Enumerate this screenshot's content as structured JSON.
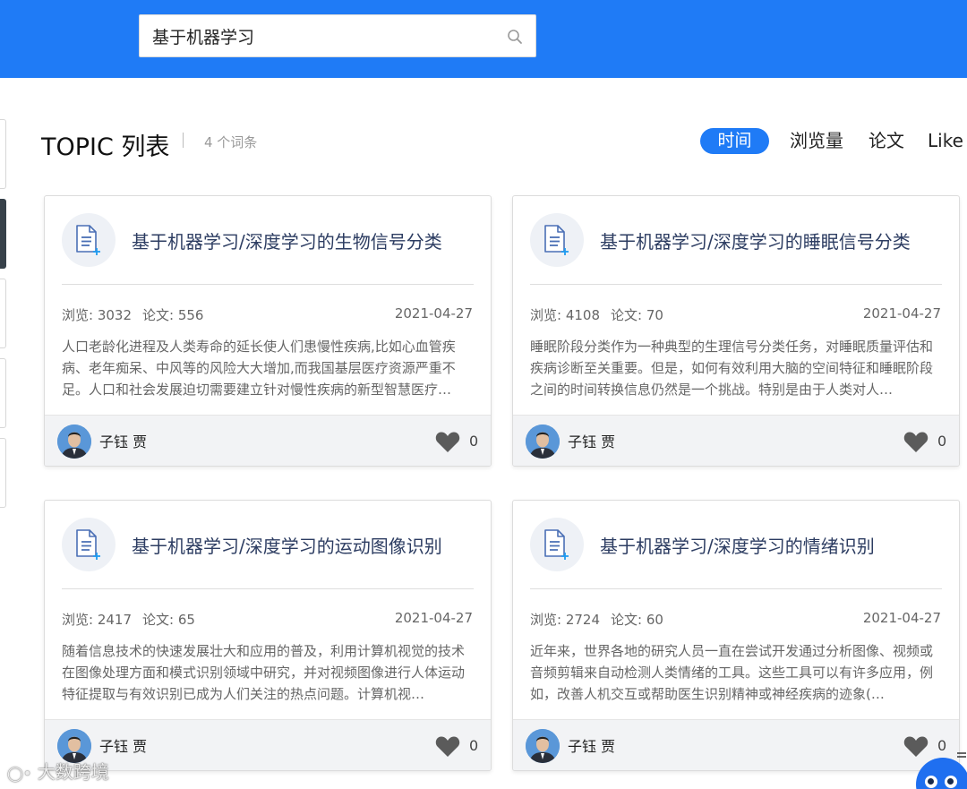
{
  "search": {
    "value": "基于机器学习"
  },
  "header": {
    "title": "TOPIC 列表",
    "count": "4 个词条"
  },
  "sort": {
    "active": "时间",
    "options": [
      "浏览量",
      "论文",
      "Like"
    ]
  },
  "cards": [
    {
      "title": "基于机器学习/深度学习的生物信号分类",
      "views": "浏览: 3032",
      "papers": "论文: 556",
      "date": "2021-04-27",
      "description": "人口老龄化进程及人类寿命的延长使人们患慢性疾病,比如心血管疾病、老年痴呆、中风等的风险大大增加,而我国基层医疗资源严重不足。人口和社会发展迫切需要建立针对慢性疾病的新型智慧医疗…",
      "author": "子钰 贾",
      "likes": "0"
    },
    {
      "title": "基于机器学习/深度学习的睡眠信号分类",
      "views": "浏览: 4108",
      "papers": "论文: 70",
      "date": "2021-04-27",
      "description": "睡眠阶段分类作为一种典型的生理信号分类任务，对睡眠质量评估和疾病诊断至关重要。但是，如何有效利用大脑的空间特征和睡眠阶段之间的时间转换信息仍然是一个挑战。特别是由于人类对人…",
      "author": "子钰 贾",
      "likes": "0"
    },
    {
      "title": "基于机器学习/深度学习的运动图像识别",
      "views": "浏览: 2417",
      "papers": "论文: 65",
      "date": "2021-04-27",
      "description": "随着信息技术的快速发展壮大和应用的普及，利用计算机视觉的技术在图像处理方面和模式识别领域中研究，并对视频图像进行人体运动特征提取与有效识别已成为人们关注的热点问题。计算机视…",
      "author": "子钰 贾",
      "likes": "0"
    },
    {
      "title": "基于机器学习/深度学习的情绪识别",
      "views": "浏览: 2724",
      "papers": "论文: 60",
      "date": "2021-04-27",
      "description": "近年来，世界各地的研究人员一直在尝试开发通过分析图像、视频或音频剪辑来自动检测人类情绪的工具。这些工具可以有许多应用，例如，改善人机交互或帮助医生识别精神或神经疾病的迹象(…",
      "author": "子钰 贾",
      "likes": "0"
    }
  ],
  "watermark": "大数跨境",
  "colors": {
    "brand": "#1f7bf6",
    "card_title": "#2d3d62",
    "footer_bg": "#f2f3f5"
  }
}
